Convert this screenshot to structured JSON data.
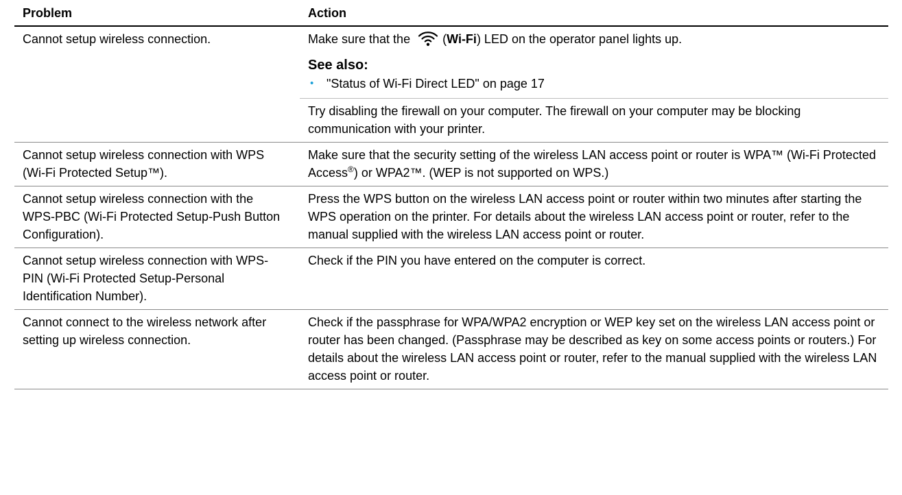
{
  "table": {
    "headers": {
      "problem": "Problem",
      "action": "Action"
    },
    "row1": {
      "problem": "Cannot setup wireless connection.",
      "action1_before": "Make sure that the",
      "action1_icon": "wifi-icon",
      "action1_open": "(",
      "action1_bold": "Wi-Fi",
      "action1_after": ") LED on the operator panel lights up.",
      "see_also_heading": "See also:",
      "see_also_item": "\"Status of Wi-Fi Direct LED\" on page 17",
      "action2": "Try disabling the firewall on your computer. The firewall on your computer may be blocking communication with your printer."
    },
    "row2": {
      "problem": "Cannot setup wireless connection with WPS (Wi-Fi Protected Setup™).",
      "action_part1": "Make sure that the security setting of the wireless LAN access point or router is WPA™ (Wi-Fi Protected Access",
      "action_sup": "®",
      "action_part2": ") or WPA2™. (WEP is not supported on WPS.)"
    },
    "row3": {
      "problem": "Cannot setup wireless connection with the WPS-PBC (Wi-Fi Protected Setup-Push Button Configuration).",
      "action": "Press the WPS button on the wireless LAN access point or router within two minutes after starting the WPS operation on the printer. For details about the wireless LAN access point or router, refer to the manual supplied with the wireless LAN access point or router."
    },
    "row4": {
      "problem": "Cannot setup wireless connection with WPS-PIN (Wi-Fi Protected Setup-Personal Identification Number).",
      "action": "Check if the PIN you have entered on the computer is correct."
    },
    "row5": {
      "problem": "Cannot connect to the wireless network after setting up wireless connection.",
      "action": "Check if the passphrase for WPA/WPA2 encryption or WEP key set on the wireless LAN access point or router has been changed. (Passphrase may be described as key on some access points or routers.) For details about the wireless LAN access point or router, refer to the manual supplied with the wireless LAN access point or router."
    }
  },
  "colors": {
    "bullet": "#1ba0d8",
    "rule": "#8a8a8a"
  }
}
